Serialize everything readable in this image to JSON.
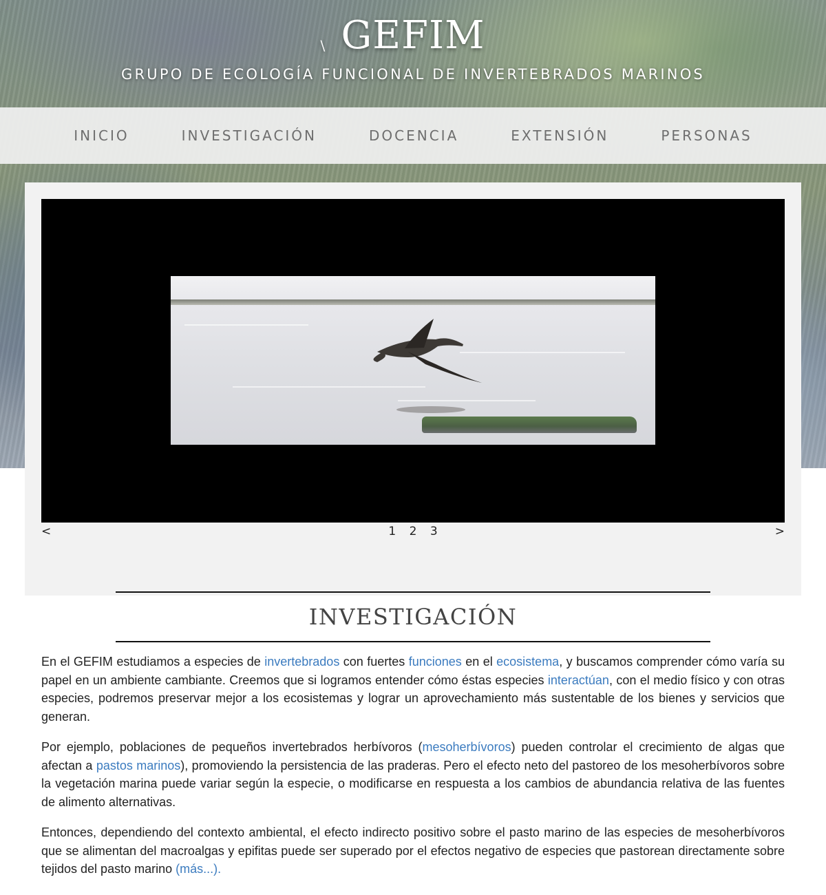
{
  "header": {
    "logo": "GEFIM",
    "subtitle": "GRUPO DE ECOLOGÍA FUNCIONAL DE INVERTEBRADOS MARINOS"
  },
  "nav": {
    "items": [
      {
        "label": "INICIO"
      },
      {
        "label": "INVESTIGACIÓN"
      },
      {
        "label": "DOCENCIA"
      },
      {
        "label": "EXTENSIÓN"
      },
      {
        "label": "PERSONAS"
      }
    ]
  },
  "slider": {
    "prev": "<",
    "next": ">",
    "pages": [
      "1",
      "2",
      "3"
    ]
  },
  "section": {
    "title": "INVESTIGACIÓN",
    "p1": {
      "t1": "En el GEFIM estudiamos a especies de ",
      "l1": "invertebrados",
      "t2": " con fuertes ",
      "l2": "funciones",
      "t3": " en el ",
      "l3": "ecosistema",
      "t4": ", y buscamos comprender cómo varía su papel en un ambiente cambiante. Creemos que si logramos entender cómo éstas especies ",
      "l4": "interactúan",
      "t5": ", con el medio físico y con otras especies, podremos preservar mejor a los ecosistemas y lograr un aprovechamiento más sustentable de los bienes y servicios que generan."
    },
    "p2": {
      "t1": "Por ejemplo, poblaciones de pequeños invertebrados herbívoros (",
      "l1": "mesoherbívoros",
      "t2": ") pueden controlar el crecimiento de algas que afectan a ",
      "l2": "pastos marinos",
      "t3": "), promoviendo la persistencia de las praderas. Pero el efecto neto del pastoreo de los mesoherbívoros sobre la vegetación marina puede variar según la especie, o modificarse en respuesta a los cambios de abundancia relativa de las fuentes de alimento alternativas."
    },
    "p3": {
      "t1": "Entonces, dependiendo del contexto ambiental, el efecto indirecto positivo sobre el pasto marino de las especies de mesoherbívoros que se alimentan del macroalgas y epifitas puede ser superado por el efectos negativo de especies que pastorean directamente sobre tejidos del pasto marino ",
      "l1": "(más...)."
    }
  }
}
